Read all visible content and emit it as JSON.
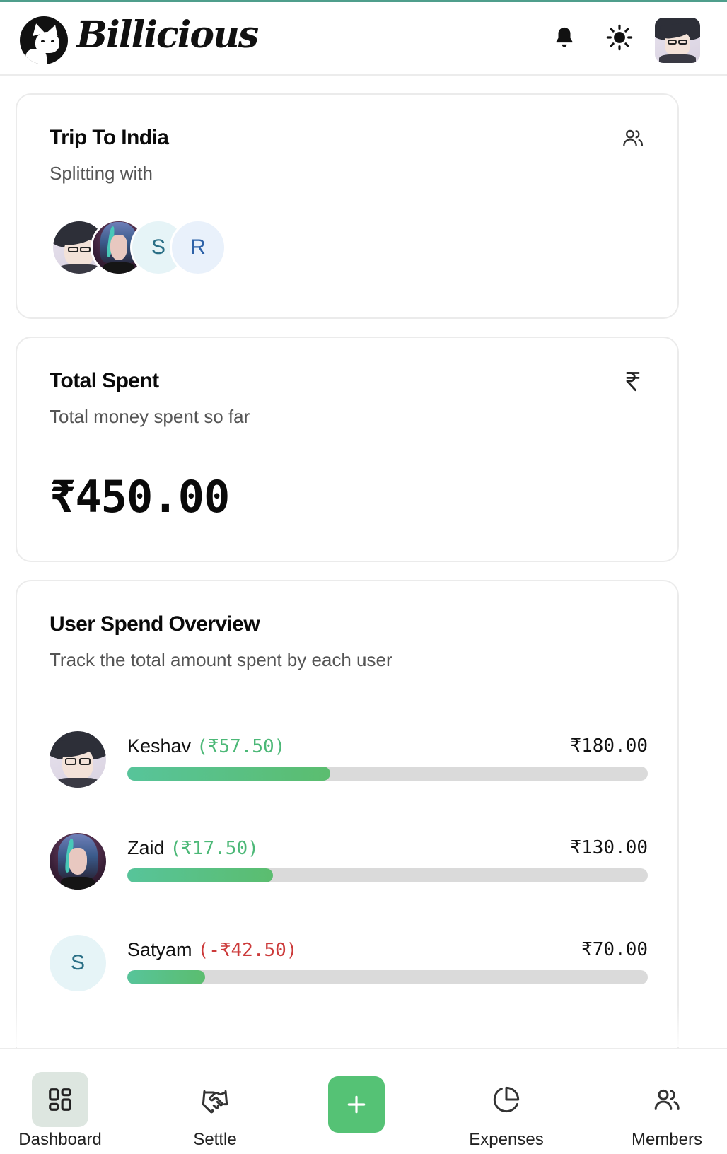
{
  "app": {
    "brand": "Billicious"
  },
  "group": {
    "title": "Trip To India",
    "subtitle": "Splitting with",
    "members": [
      {
        "type": "image",
        "name": "keshav"
      },
      {
        "type": "image",
        "name": "zaid"
      },
      {
        "type": "letter",
        "letter": "S"
      },
      {
        "type": "letter",
        "letter": "R"
      }
    ]
  },
  "total": {
    "title": "Total Spent",
    "subtitle": "Total money spent so far",
    "icon": "rupee-icon",
    "amount": "₹450.00"
  },
  "overview": {
    "title": "User Spend Overview",
    "subtitle": "Track the total amount spent by each user",
    "users": [
      {
        "name": "Keshav",
        "delta": "(₹57.50)",
        "delta_sign": "positive",
        "total": "₹180.00",
        "share_percent": 39
      },
      {
        "name": "Zaid",
        "delta": "(₹17.50)",
        "delta_sign": "positive",
        "total": "₹130.00",
        "share_percent": 28
      },
      {
        "name": "Satyam",
        "delta": "(-₹42.50)",
        "delta_sign": "negative",
        "total": "₹70.00",
        "share_percent": 15,
        "avatar_letter": "S"
      }
    ]
  },
  "nav": {
    "items": [
      {
        "label": "Dashboard",
        "icon": "dashboard-icon",
        "active": true
      },
      {
        "label": "Settle",
        "icon": "handshake-icon",
        "active": false
      },
      {
        "label": "",
        "icon": "plus-icon",
        "active": false
      },
      {
        "label": "Expenses",
        "icon": "pie-chart-icon",
        "active": false
      },
      {
        "label": "Members",
        "icon": "users-icon",
        "active": false
      }
    ]
  },
  "colors": {
    "accent_green": "#55c275",
    "positive": "#4cb877",
    "negative": "#cc3a3a",
    "bar_track": "#dadada"
  }
}
